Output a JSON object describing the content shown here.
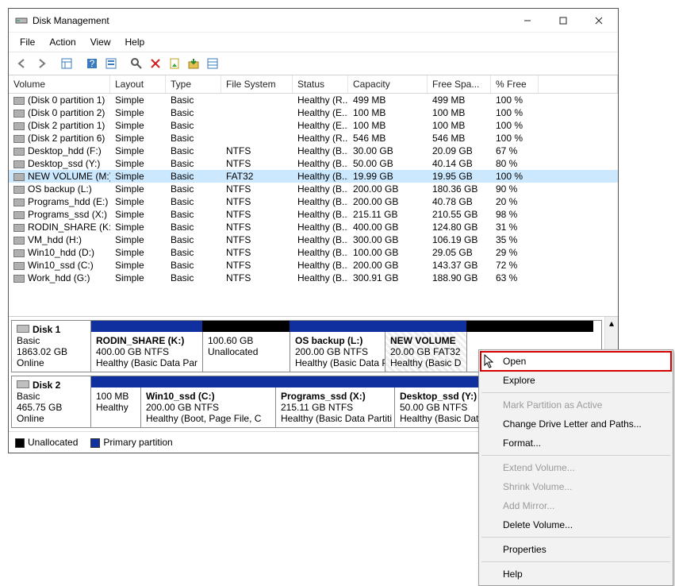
{
  "window": {
    "title": "Disk Management"
  },
  "menubar": [
    "File",
    "Action",
    "View",
    "Help"
  ],
  "columns": [
    "Volume",
    "Layout",
    "Type",
    "File System",
    "Status",
    "Capacity",
    "Free Spa...",
    "% Free"
  ],
  "volumes": [
    {
      "name": "(Disk 0 partition 1)",
      "layout": "Simple",
      "vtype": "Basic",
      "fs": "",
      "status": "Healthy (R...",
      "cap": "499 MB",
      "free": "499 MB",
      "pct": "100 %"
    },
    {
      "name": "(Disk 0 partition 2)",
      "layout": "Simple",
      "vtype": "Basic",
      "fs": "",
      "status": "Healthy (E...",
      "cap": "100 MB",
      "free": "100 MB",
      "pct": "100 %"
    },
    {
      "name": "(Disk 2 partition 1)",
      "layout": "Simple",
      "vtype": "Basic",
      "fs": "",
      "status": "Healthy (E...",
      "cap": "100 MB",
      "free": "100 MB",
      "pct": "100 %"
    },
    {
      "name": "(Disk 2 partition 6)",
      "layout": "Simple",
      "vtype": "Basic",
      "fs": "",
      "status": "Healthy (R...",
      "cap": "546 MB",
      "free": "546 MB",
      "pct": "100 %"
    },
    {
      "name": "Desktop_hdd (F:)",
      "layout": "Simple",
      "vtype": "Basic",
      "fs": "NTFS",
      "status": "Healthy (B...",
      "cap": "30.00 GB",
      "free": "20.09 GB",
      "pct": "67 %"
    },
    {
      "name": "Desktop_ssd (Y:)",
      "layout": "Simple",
      "vtype": "Basic",
      "fs": "NTFS",
      "status": "Healthy (B...",
      "cap": "50.00 GB",
      "free": "40.14 GB",
      "pct": "80 %"
    },
    {
      "name": "NEW VOLUME (M:)",
      "layout": "Simple",
      "vtype": "Basic",
      "fs": "FAT32",
      "status": "Healthy (B...",
      "cap": "19.99 GB",
      "free": "19.95 GB",
      "pct": "100 %",
      "sel": true
    },
    {
      "name": "OS backup (L:)",
      "layout": "Simple",
      "vtype": "Basic",
      "fs": "NTFS",
      "status": "Healthy (B...",
      "cap": "200.00 GB",
      "free": "180.36 GB",
      "pct": "90 %"
    },
    {
      "name": "Programs_hdd (E:)",
      "layout": "Simple",
      "vtype": "Basic",
      "fs": "NTFS",
      "status": "Healthy (B...",
      "cap": "200.00 GB",
      "free": "40.78 GB",
      "pct": "20 %"
    },
    {
      "name": "Programs_ssd (X:)",
      "layout": "Simple",
      "vtype": "Basic",
      "fs": "NTFS",
      "status": "Healthy (B...",
      "cap": "215.11 GB",
      "free": "210.55 GB",
      "pct": "98 %"
    },
    {
      "name": "RODIN_SHARE (K:)",
      "layout": "Simple",
      "vtype": "Basic",
      "fs": "NTFS",
      "status": "Healthy (B...",
      "cap": "400.00 GB",
      "free": "124.80 GB",
      "pct": "31 %"
    },
    {
      "name": "VM_hdd (H:)",
      "layout": "Simple",
      "vtype": "Basic",
      "fs": "NTFS",
      "status": "Healthy (B...",
      "cap": "300.00 GB",
      "free": "106.19 GB",
      "pct": "35 %"
    },
    {
      "name": "Win10_hdd (D:)",
      "layout": "Simple",
      "vtype": "Basic",
      "fs": "NTFS",
      "status": "Healthy (B...",
      "cap": "100.00 GB",
      "free": "29.05 GB",
      "pct": "29 %"
    },
    {
      "name": "Win10_ssd (C:)",
      "layout": "Simple",
      "vtype": "Basic",
      "fs": "NTFS",
      "status": "Healthy (B...",
      "cap": "200.00 GB",
      "free": "143.37 GB",
      "pct": "72 %"
    },
    {
      "name": "Work_hdd (G:)",
      "layout": "Simple",
      "vtype": "Basic",
      "fs": "NTFS",
      "status": "Healthy (B...",
      "cap": "300.91 GB",
      "free": "188.90 GB",
      "pct": "63 %"
    }
  ],
  "disks": [
    {
      "name": "Disk 1",
      "dtype": "Basic",
      "size": "1863.02 GB",
      "state": "Online",
      "parts": [
        {
          "title": "RODIN_SHARE  (K:)",
          "line2": "400.00 GB NTFS",
          "line3": "Healthy (Basic Data Par",
          "w": 140,
          "color": "#1030a0"
        },
        {
          "title": "",
          "line2": "100.60 GB",
          "line3": "Unallocated",
          "w": 110,
          "color": "#000"
        },
        {
          "title": "OS backup  (L:)",
          "line2": "200.00 GB NTFS",
          "line3": "Healthy (Basic Data P",
          "w": 120,
          "color": "#1030a0"
        },
        {
          "title": "NEW VOLUME ",
          "line2": "20.00 GB FAT32",
          "line3": "Healthy (Basic D",
          "w": 103,
          "color": "#1030a0",
          "sel": true
        },
        {
          "title": "",
          "line2": "",
          "line3": "",
          "w": 160,
          "color": "#000"
        }
      ]
    },
    {
      "name": "Disk 2",
      "dtype": "Basic",
      "size": "465.75 GB",
      "state": "Online",
      "parts": [
        {
          "title": "",
          "line2": "100 MB",
          "line3": "Healthy",
          "w": 62,
          "color": "#1030a0"
        },
        {
          "title": "Win10_ssd  (C:)",
          "line2": "200.00 GB NTFS",
          "line3": "Healthy (Boot, Page File, C",
          "w": 170,
          "color": "#1030a0"
        },
        {
          "title": "Programs_ssd  (X:)",
          "line2": "215.11 GB NTFS",
          "line3": "Healthy (Basic Data Partiti",
          "w": 150,
          "color": "#1030a0"
        },
        {
          "title": "Desktop_ssd  (Y:)",
          "line2": "50.00 GB NTFS",
          "line3": "Healthy (Basic Data",
          "w": 108,
          "color": "#1030a0"
        },
        {
          "title": "",
          "line2": "",
          "line3": "",
          "w": 143,
          "color": "#1030a0"
        }
      ]
    }
  ],
  "legend": {
    "unalloc": "Unallocated",
    "primary": "Primary partition",
    "c_unalloc": "#000000",
    "c_primary": "#1030a0"
  },
  "context": [
    {
      "label": "Open",
      "hl": true
    },
    {
      "label": "Explore"
    },
    {
      "sep": true
    },
    {
      "label": "Mark Partition as Active",
      "disabled": true
    },
    {
      "label": "Change Drive Letter and Paths..."
    },
    {
      "label": "Format..."
    },
    {
      "sep": true
    },
    {
      "label": "Extend Volume...",
      "disabled": true
    },
    {
      "label": "Shrink Volume...",
      "disabled": true
    },
    {
      "label": "Add Mirror...",
      "disabled": true
    },
    {
      "label": "Delete Volume..."
    },
    {
      "sep": true
    },
    {
      "label": "Properties"
    },
    {
      "sep": true
    },
    {
      "label": "Help"
    }
  ]
}
